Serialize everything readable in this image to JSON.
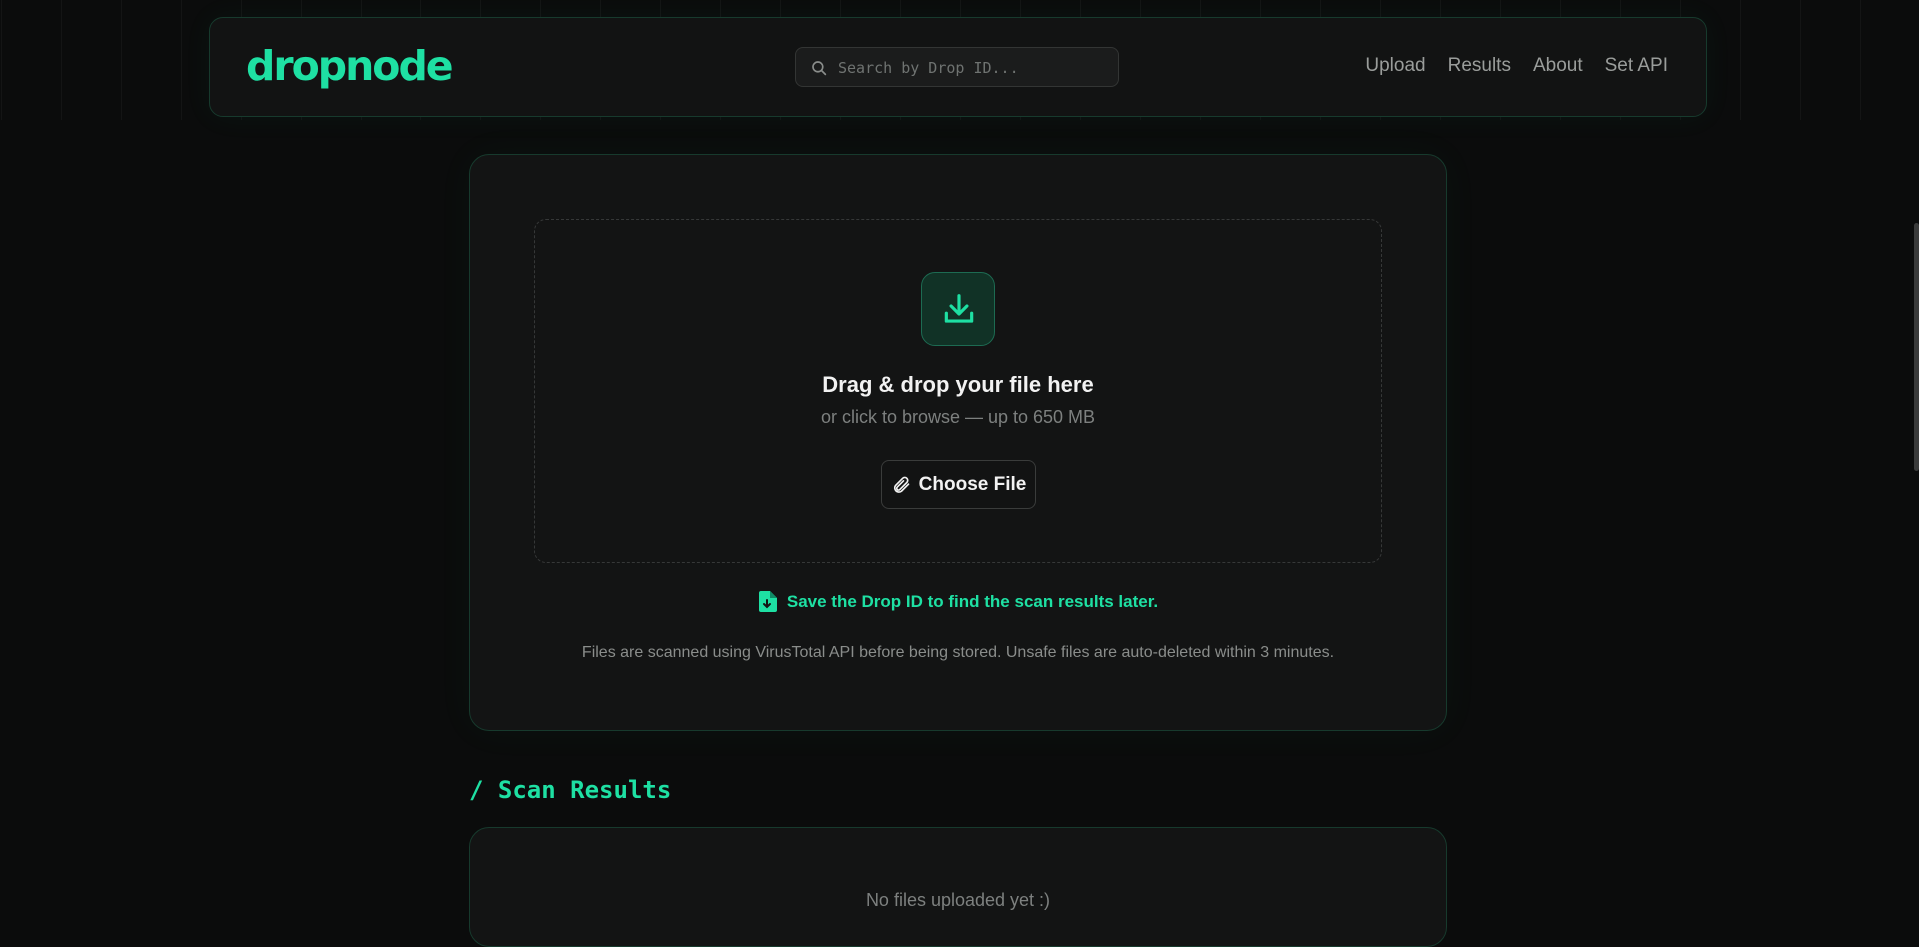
{
  "navbar": {
    "logo": "dropnode",
    "search_placeholder": "Search by Drop ID...",
    "links": [
      "Upload",
      "Results",
      "About",
      "Set API"
    ]
  },
  "upload": {
    "title": "Drag & drop your file here",
    "subtitle": "or click to browse — up to 650 MB",
    "button_label": "Choose File",
    "save_note": "Save the Drop ID to find the scan results later.",
    "info": "Files are scanned using VirusTotal API before being stored. Unsafe files are auto-deleted within 3 minutes."
  },
  "results": {
    "section_title": "/ Scan Results",
    "empty_text": "No files uploaded yet :)"
  },
  "icons": {
    "search": "search-icon",
    "download": "download-icon",
    "paperclip": "paperclip-icon",
    "file": "file-icon"
  },
  "colors": {
    "accent": "#1ee0a3",
    "background": "#0b0c0c",
    "card": "#131414",
    "border": "#173a2d"
  }
}
